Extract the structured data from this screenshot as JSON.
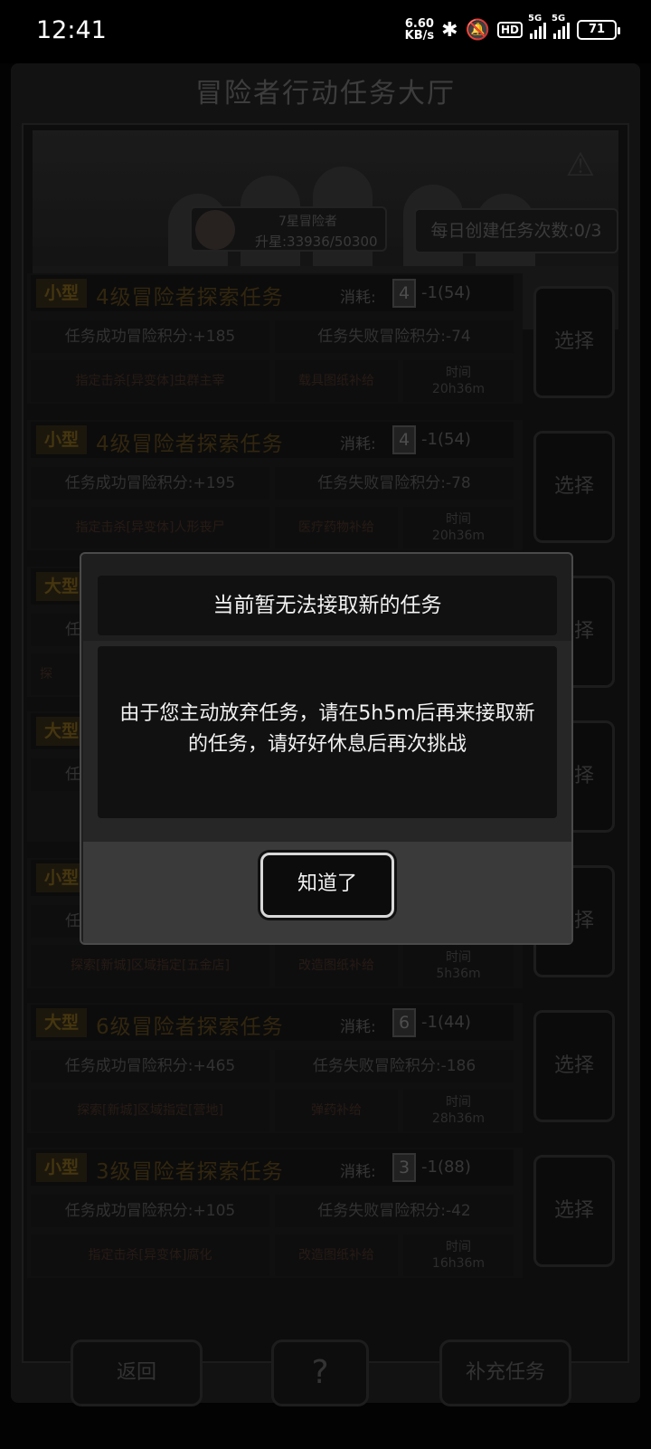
{
  "status_bar": {
    "time": "12:41",
    "net_speed_value": "6.60",
    "net_speed_unit": "KB/s",
    "hd_label": "HD",
    "signal1_label": "5G",
    "signal2_label": "5G",
    "battery": "71",
    "icons": [
      "bluetooth-icon",
      "mute-bell-icon",
      "hd-icon",
      "signal-icon",
      "battery-icon"
    ]
  },
  "header": {
    "title": "冒险者行动任务大厅"
  },
  "rank": {
    "name": "7星冒险者",
    "exp": "升星:33936/50300"
  },
  "daily": {
    "label": "每日创建任务次数:0/3"
  },
  "cost_label": "消耗:",
  "select_label": "选择",
  "time_label": "时间",
  "tasks": [
    {
      "size": "小型",
      "title": "4级冒险者探索任务",
      "card": "4",
      "cost": "-1(54)",
      "success": "任务成功冒险积分:+185",
      "fail": "任务失败冒险积分:-74",
      "objective": "指定击杀[异变体]虫群主宰",
      "reward": "载具图纸补给",
      "time": "20h36m"
    },
    {
      "size": "小型",
      "title": "4级冒险者探索任务",
      "card": "4",
      "cost": "-1(54)",
      "success": "任务成功冒险积分:+195",
      "fail": "任务失败冒险积分:-78",
      "objective": "指定击杀[异变体]人形丧尸",
      "reward": "医疗药物补给",
      "time": "20h36m"
    },
    {
      "size": "大型",
      "title": "",
      "card": "",
      "cost": "",
      "success": "任",
      "fail": "",
      "objective": "探",
      "reward": "",
      "time": ""
    },
    {
      "size": "大型",
      "title": "",
      "card": "",
      "cost": "",
      "success": "任",
      "fail": "",
      "objective": "",
      "reward": "",
      "time": ""
    },
    {
      "size": "小型",
      "title": "",
      "card": "",
      "cost": "",
      "success": "任",
      "fail": "",
      "objective": "探索[新城]区域指定[五金店]",
      "reward": "改造图纸补给",
      "time": "5h36m"
    },
    {
      "size": "大型",
      "title": "6级冒险者探索任务",
      "card": "6",
      "cost": "-1(44)",
      "success": "任务成功冒险积分:+465",
      "fail": "任务失败冒险积分:-186",
      "objective": "探索[新城]区域指定[营地]",
      "reward": "弹药补给",
      "time": "28h36m"
    },
    {
      "size": "小型",
      "title": "3级冒险者探索任务",
      "card": "3",
      "cost": "-1(88)",
      "success": "任务成功冒险积分:+105",
      "fail": "任务失败冒险积分:-42",
      "objective": "指定击杀[异变体]腐化",
      "reward": "改造图纸补给",
      "time": "16h36m"
    }
  ],
  "bottom": {
    "back": "返回",
    "help_icon": "help-map-icon",
    "supplement": "补充任务"
  },
  "dialog": {
    "title": "当前暂无法接取新的任务",
    "body_line1": "由于您主动放弃任务，请在5h5m后再来接取新",
    "body_line2": "的任务，请好好休息后再次挑战",
    "ok": "知道了"
  }
}
